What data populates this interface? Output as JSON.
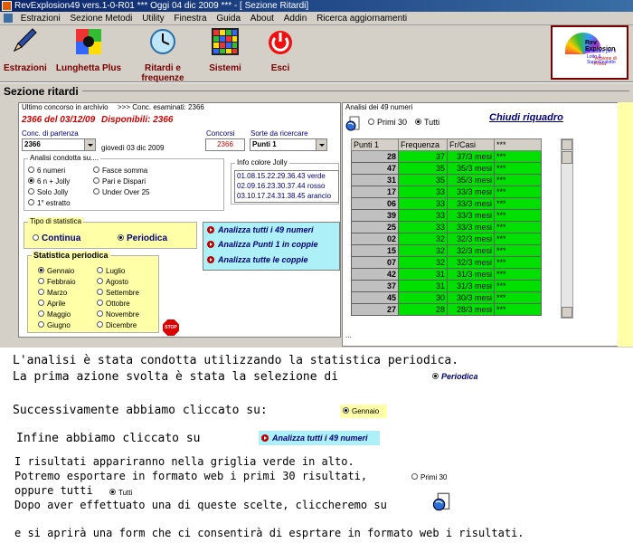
{
  "window": {
    "title": "RevExplosion49 vers.1-0-R01   ***  Oggi 04 dic 2009   ***   - [ Sezione Ritardi]"
  },
  "menu": [
    "Estrazioni",
    "Sezione Metodi",
    "Utility",
    "Finestra",
    "Guida",
    "About",
    "Addin",
    "Ricerca aggiornamenti"
  ],
  "toolbar": {
    "estrazioni": "Estrazioni",
    "lunghetta": "Lunghetta Plus",
    "ritardi": "Ritardi e frequenze",
    "sistemi": "Sistemi",
    "esci": "Esci",
    "logo_title": "Rev Explosion",
    "logo_sub": "Software per il Lotto & SuperEnalotto",
    "logo_author": "Versione di Prova"
  },
  "section": {
    "title": "Sezione ritardi",
    "ultimo_label": "Ultimo concorso in archivio",
    "conc_esaminati": ">>> Conc. esaminati: 2366",
    "ultimo_value": "2366 del 03/12/09",
    "disponibili": "Disponibili: 2366",
    "conc_partenza_label": "Conc. di partenza",
    "conc_partenza_value": "2366",
    "giorno": "giovedì 03 dic 2009",
    "concorsi_label": "Concorsi",
    "concorsi_value": "2366",
    "sorte_label": "Sorte da ricercare",
    "sorte_value": "Punti 1",
    "analisi_label": "Analisi condotta su....",
    "analisi_options": [
      "6 numeri",
      "6 n + Jolly",
      "Solo Jolly",
      "1° estratto",
      "Fasce somma",
      "Pari e Dispari",
      "Under Over 25"
    ],
    "info_label": "Info colore Jolly",
    "info_lines": [
      "01.08.15.22.29.36.43 verde",
      "02.09.16.23.30.37.44 rosso",
      "03.10.17.24.31.38.45 arancio"
    ],
    "tipo_label": "Tipo di statistica",
    "tipo_continua": "Continua",
    "tipo_periodica": "Periodica",
    "stat_periodica_label": "Statistica periodica",
    "mesi": [
      "Gennaio",
      "Febbraio",
      "Marzo",
      "Aprile",
      "Maggio",
      "Giugno",
      "Luglio",
      "Agosto",
      "Settembre",
      "Ottobre",
      "Novembre",
      "Dicembre"
    ],
    "stop_label": "STOP",
    "actions": [
      "Analizza tutti i 49 numeri",
      "Analizza Punti 1 in coppie",
      "Analizza tutte le coppie"
    ]
  },
  "analysis": {
    "title": "Analisi dei 49 numeri",
    "primi30": "Primi 30",
    "tutti": "Tutti",
    "chiudi": "Chiudi riquadro",
    "ellipsis": "...",
    "headers": [
      "Punti 1",
      "Frequenza",
      "Fr/Casi",
      "***"
    ],
    "rows": [
      [
        "28",
        "37",
        "37/3 mesi",
        "***"
      ],
      [
        "47",
        "35",
        "35/3 mesi",
        "***"
      ],
      [
        "31",
        "35",
        "35/3 mesi",
        "***"
      ],
      [
        "17",
        "33",
        "33/3 mesi",
        "***"
      ],
      [
        "06",
        "33",
        "33/3 mesi",
        "***"
      ],
      [
        "39",
        "33",
        "33/3 mesi",
        "***"
      ],
      [
        "25",
        "33",
        "33/3 mesi",
        "***"
      ],
      [
        "02",
        "32",
        "32/3 mesi",
        "***"
      ],
      [
        "15",
        "32",
        "32/3 mesi",
        "***"
      ],
      [
        "07",
        "32",
        "32/3 mesi",
        "***"
      ],
      [
        "42",
        "31",
        "31/3 mesi",
        "***"
      ],
      [
        "37",
        "31",
        "31/3 mesi",
        "***"
      ],
      [
        "45",
        "30",
        "30/3 mesi",
        "***"
      ],
      [
        "27",
        "28",
        "28/3 mesi",
        "***"
      ]
    ]
  },
  "explain": {
    "l1": "L'analisi è stata condotta utilizzando la statistica periodica.",
    "l2": "La prima azione svolta è stata la selezione di",
    "chip_periodica": "Periodica",
    "l3": "Successivamente abbiamo cliccato su:",
    "chip_gennaio": "Gennaio",
    "l4": "Infine abbiamo cliccato su",
    "chip_analizza": "Analizza tutti i 49 numeri",
    "l5": "I risultati appariranno nella griglia verde in alto.",
    "l6": "Potremo esportare in formato web i primi 30 risultati,",
    "chip_primi30": "Primi 30",
    "l7": "oppure tutti",
    "chip_tutti": "Tutti",
    "l8": "Dopo aver effettuato una di queste scelte, cliccheremo su",
    "l9": "e si aprirà una form che ci consentirà di esprtare in formato web i risultati."
  }
}
